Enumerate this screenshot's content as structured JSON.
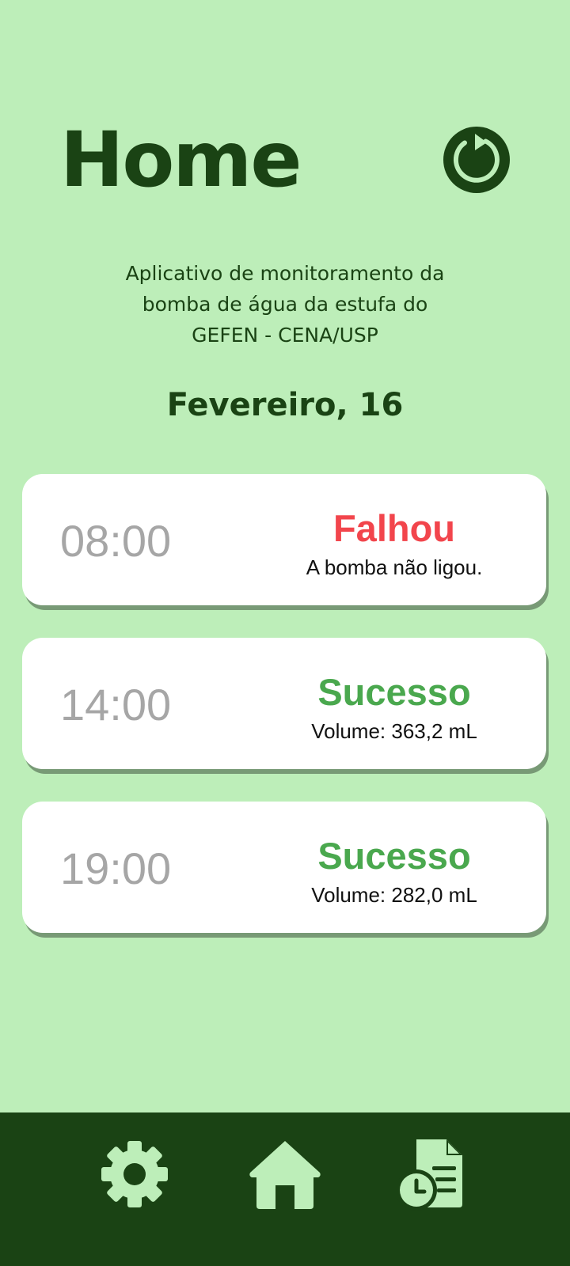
{
  "header": {
    "title": "Home"
  },
  "description": {
    "line1": "Aplicativo de monitoramento da",
    "line2": "bomba de água da estufa do",
    "line3": "GEFEN - CENA/USP"
  },
  "date_label": "Fevereiro, 16",
  "records": [
    {
      "time": "08:00",
      "status": "Falhou",
      "detail": "A bomba não ligou."
    },
    {
      "time": "14:00",
      "status": "Sucesso",
      "detail": "Volume: 363,2 mL"
    },
    {
      "time": "19:00",
      "status": "Sucesso",
      "detail": "Volume: 282,0 mL"
    }
  ],
  "colors": {
    "background": "#bdeeb9",
    "dark_green": "#1a4314",
    "failure": "#f2454c",
    "success": "#4aa84e",
    "time_gray": "#a6a6a6"
  },
  "icons": {
    "refresh": "refresh-icon",
    "settings": "gear-icon",
    "home": "home-icon",
    "report": "document-clock-icon"
  }
}
